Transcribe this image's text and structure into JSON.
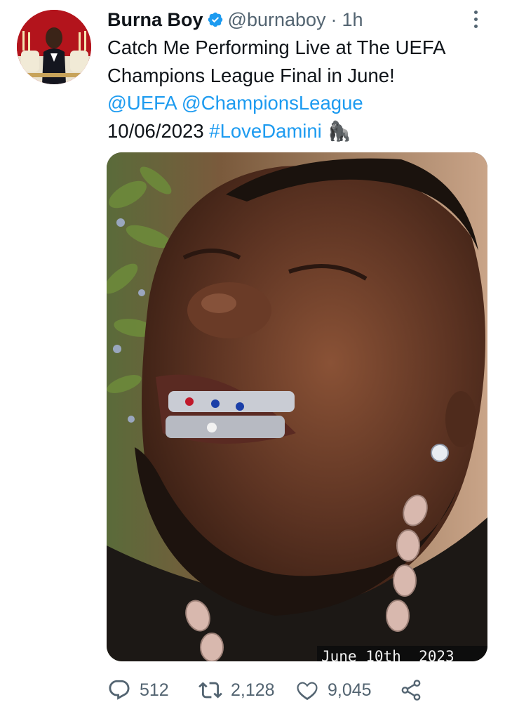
{
  "tweet": {
    "author_name": "Burna Boy",
    "author_handle": "@burnaboy",
    "separator": "·",
    "timestamp": "1h",
    "text_line1": "Catch Me Performing Live at The UEFA Champions League Final in June!",
    "mention_uefa": "@UEFA",
    "mention_cl": "@ChampionsLeague",
    "date_text": "10/06/2023",
    "hashtag": "#LoveDamini",
    "emoji": "🦍",
    "media_caption": "June 10th  2023"
  },
  "actions": {
    "replies": "512",
    "retweets": "2,128",
    "likes": "9,045"
  },
  "icons": {
    "verified": "verified-badge-icon",
    "more": "more-vertical-icon",
    "reply": "reply-icon",
    "retweet": "retweet-icon",
    "like": "heart-icon",
    "share": "share-icon"
  },
  "colors": {
    "link": "#1d9bf0",
    "secondary_text": "#536471",
    "primary_text": "#0f1419"
  }
}
